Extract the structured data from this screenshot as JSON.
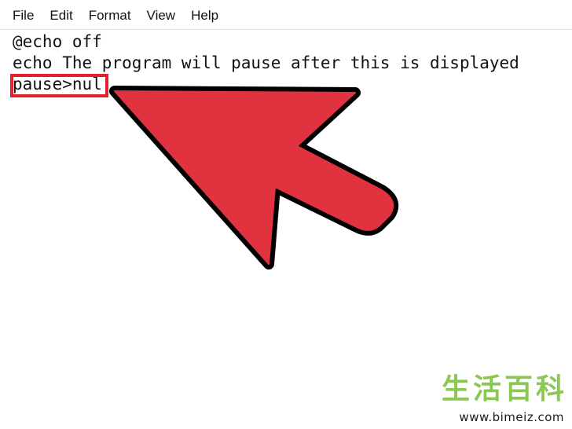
{
  "menu": {
    "items": [
      {
        "label": "File"
      },
      {
        "label": "Edit"
      },
      {
        "label": "Format"
      },
      {
        "label": "View"
      },
      {
        "label": "Help"
      }
    ]
  },
  "editor": {
    "lines": [
      "@echo off",
      "echo The program will pause after this is displayed",
      "pause>nul"
    ]
  },
  "annotation": {
    "highlight_color": "#e0222c",
    "arrow_fill": "#e0333f",
    "arrow_outline": "#000000"
  },
  "watermark": {
    "chars": [
      "生",
      "活",
      "百",
      "科"
    ],
    "url": "www.bimeiz.com",
    "color": "#7fc241"
  }
}
